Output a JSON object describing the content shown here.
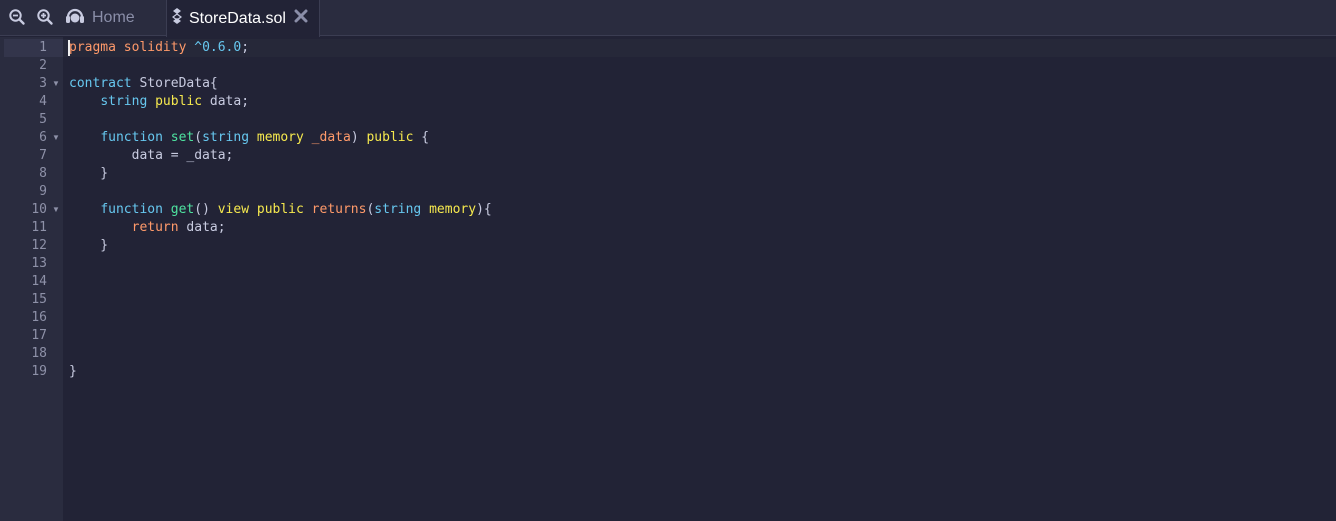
{
  "tabs": [
    {
      "label": "Home",
      "icon": "remix-logo-icon"
    },
    {
      "label": "StoreData.sol",
      "icon": "solidity-file-icon",
      "close_icon": "close-icon"
    }
  ],
  "toolbar": {
    "zoom_out_icon": "zoom-out-icon",
    "zoom_in_icon": "zoom-in-icon"
  },
  "editor": {
    "line_numbers": [
      "1",
      "2",
      "3",
      "4",
      "5",
      "6",
      "7",
      "8",
      "9",
      "10",
      "11",
      "12",
      "13",
      "14",
      "15",
      "16",
      "17",
      "18",
      "19"
    ],
    "fold_lines": [
      "3",
      "6",
      "10"
    ],
    "active_line": "1",
    "code": [
      [
        {
          "t": "pragma",
          "c": "orange"
        },
        {
          "t": " ",
          "c": "plain"
        },
        {
          "t": "solidity",
          "c": "orange"
        },
        {
          "t": " ",
          "c": "plain"
        },
        {
          "t": "^0.6.0",
          "c": "blue"
        },
        {
          "t": ";",
          "c": "plain"
        }
      ],
      [],
      [
        {
          "t": "contract",
          "c": "blue"
        },
        {
          "t": " StoreData{",
          "c": "plain"
        }
      ],
      [
        {
          "t": "    ",
          "c": "plain"
        },
        {
          "t": "string",
          "c": "blue"
        },
        {
          "t": " ",
          "c": "plain"
        },
        {
          "t": "public",
          "c": "yellow"
        },
        {
          "t": " data;",
          "c": "plain"
        }
      ],
      [],
      [
        {
          "t": "    ",
          "c": "plain"
        },
        {
          "t": "function",
          "c": "blue"
        },
        {
          "t": " ",
          "c": "plain"
        },
        {
          "t": "set",
          "c": "green"
        },
        {
          "t": "(",
          "c": "plain"
        },
        {
          "t": "string",
          "c": "blue"
        },
        {
          "t": " ",
          "c": "plain"
        },
        {
          "t": "memory",
          "c": "yellow"
        },
        {
          "t": " ",
          "c": "plain"
        },
        {
          "t": "_data",
          "c": "orange"
        },
        {
          "t": ") ",
          "c": "plain"
        },
        {
          "t": "public",
          "c": "yellow"
        },
        {
          "t": " {",
          "c": "plain"
        }
      ],
      [
        {
          "t": "        data = _data;",
          "c": "plain"
        }
      ],
      [
        {
          "t": "    }",
          "c": "plain"
        }
      ],
      [],
      [
        {
          "t": "    ",
          "c": "plain"
        },
        {
          "t": "function",
          "c": "blue"
        },
        {
          "t": " ",
          "c": "plain"
        },
        {
          "t": "get",
          "c": "green"
        },
        {
          "t": "() ",
          "c": "plain"
        },
        {
          "t": "view",
          "c": "yellow"
        },
        {
          "t": " ",
          "c": "plain"
        },
        {
          "t": "public",
          "c": "yellow"
        },
        {
          "t": " ",
          "c": "plain"
        },
        {
          "t": "returns",
          "c": "orange"
        },
        {
          "t": "(",
          "c": "plain"
        },
        {
          "t": "string",
          "c": "blue"
        },
        {
          "t": " ",
          "c": "plain"
        },
        {
          "t": "memory",
          "c": "yellow"
        },
        {
          "t": "){",
          "c": "plain"
        }
      ],
      [
        {
          "t": "        ",
          "c": "plain"
        },
        {
          "t": "return",
          "c": "orange"
        },
        {
          "t": " data;",
          "c": "plain"
        }
      ],
      [
        {
          "t": "    }",
          "c": "plain"
        }
      ],
      [],
      [],
      [],
      [],
      [],
      [],
      [
        {
          "t": "}",
          "c": "plain"
        }
      ]
    ]
  },
  "colors": {
    "background": "#222336",
    "gutter": "#2a2c3f",
    "keyword_orange": "#ff9a6a",
    "keyword_blue": "#67c8f0",
    "keyword_yellow": "#f6e94e",
    "function_green": "#4ee3a0"
  }
}
